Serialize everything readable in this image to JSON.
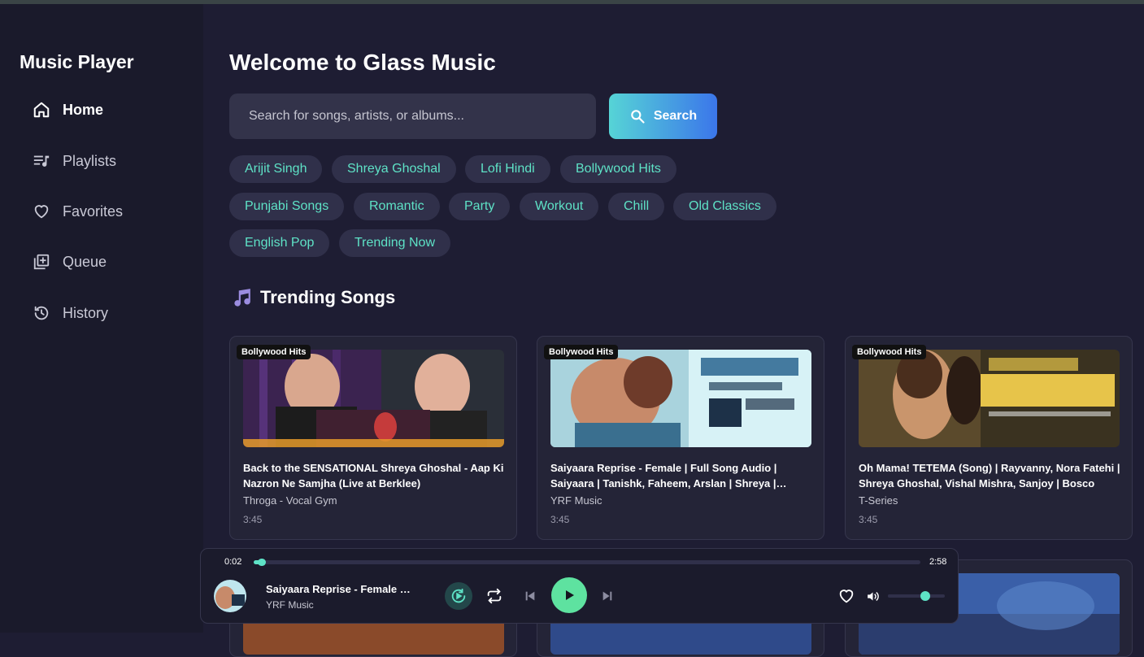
{
  "sidebar": {
    "brand": "Music Player",
    "items": [
      {
        "label": "Home",
        "icon": "home-icon",
        "active": true
      },
      {
        "label": "Playlists",
        "icon": "playlist-icon"
      },
      {
        "label": "Favorites",
        "icon": "heart-icon"
      },
      {
        "label": "Queue",
        "icon": "queue-icon"
      },
      {
        "label": "History",
        "icon": "history-icon"
      }
    ]
  },
  "main": {
    "welcome": "Welcome to Glass Music",
    "search": {
      "placeholder": "Search for songs, artists, or albums...",
      "button_label": "Search"
    },
    "chips": [
      "Arijit Singh",
      "Shreya Ghoshal",
      "Lofi Hindi",
      "Bollywood Hits",
      "Punjabi Songs",
      "Romantic",
      "Party",
      "Workout",
      "Chill",
      "Old Classics",
      "English Pop",
      "Trending Now"
    ],
    "section_title": "Trending Songs",
    "cards": [
      {
        "badge": "Bollywood Hits",
        "title": "Back to the SENSATIONAL Shreya Ghoshal - Aap Ki Nazron Ne Samjha (Live at Berklee)",
        "artist": "Throga - Vocal Gym",
        "duration": "3:45"
      },
      {
        "badge": "Bollywood Hits",
        "title": "Saiyaara Reprise - Female | Full Song Audio | Saiyaara | Tanishk, Faheem, Arslan | Shreya | Ahaan, Aneet",
        "artist": "YRF Music",
        "duration": "3:45"
      },
      {
        "badge": "Bollywood Hits",
        "title": "Oh Mama! TETEMA (Song) | Rayvanny, Nora Fatehi | Shreya Ghoshal, Vishal Mishra, Sanjoy | Bosco",
        "artist": "T-Series",
        "duration": "3:45"
      }
    ]
  },
  "player": {
    "current_time": "0:02",
    "total_time": "2:58",
    "progress": 0.012,
    "title": "Saiyaara Reprise - Female | Full Song Audio",
    "artist": "YRF Music",
    "volume": 0.65
  },
  "colors": {
    "accent": "#5ee2c6",
    "bg": "#1e1d33",
    "sidebar": "#1a1a2b",
    "chip_bg": "#30304a"
  }
}
